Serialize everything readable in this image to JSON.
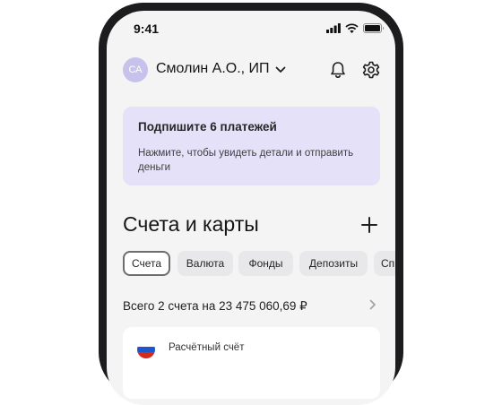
{
  "status_bar": {
    "time": "9:41"
  },
  "header": {
    "avatar_initials": "СА",
    "account_name": "Смолин А.О., ИП"
  },
  "banner": {
    "title": "Подпишите 6 платежей",
    "text": "Нажмите, чтобы увидеть детали и отправить деньги"
  },
  "section": {
    "title": "Счета и карты"
  },
  "tabs": [
    {
      "label": "Счета"
    },
    {
      "label": "Валюта"
    },
    {
      "label": "Фонды"
    },
    {
      "label": "Депозиты"
    },
    {
      "label": "Сп"
    }
  ],
  "summary": {
    "total_text": "Всего 2 счета на 23 475 060,69 ₽"
  },
  "account": {
    "label": "Расчётный счёт"
  },
  "colors": {
    "accent": "#c7c2ec",
    "banner_bg": "#e4e1f8",
    "screen_bg": "#f4f4f5"
  }
}
